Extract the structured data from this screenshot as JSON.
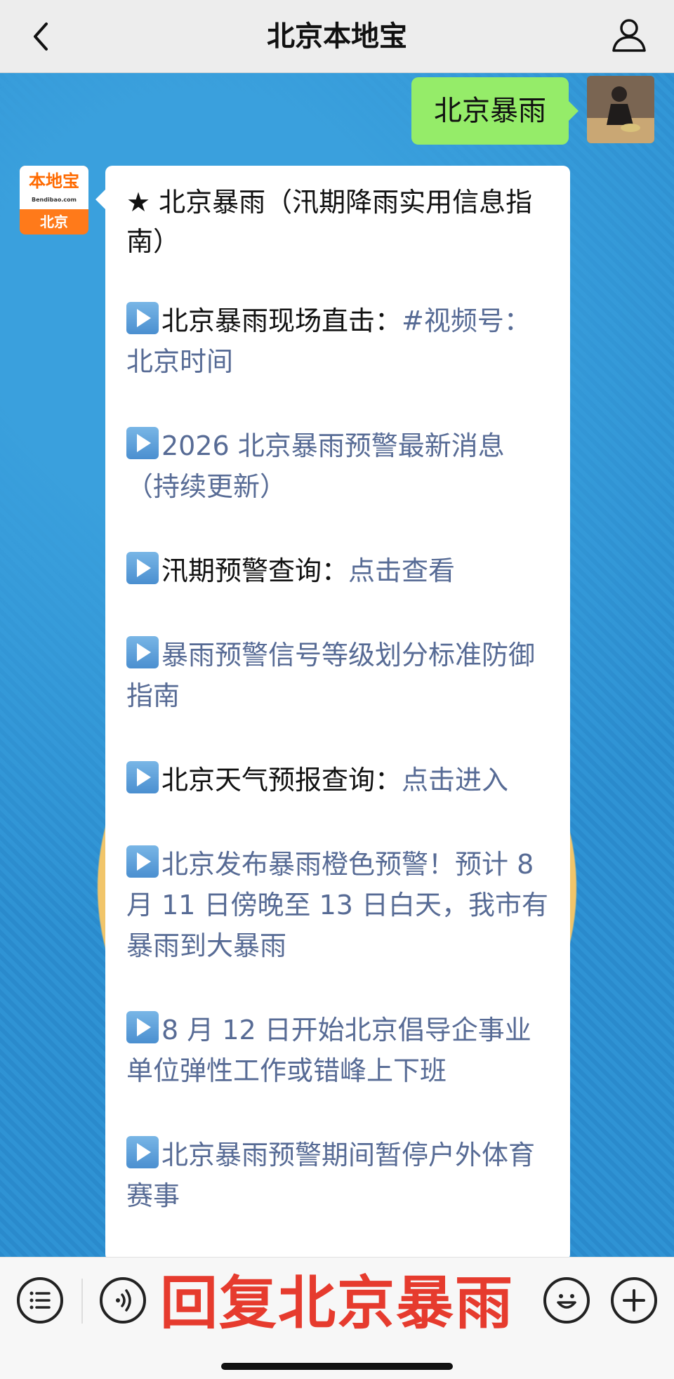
{
  "header": {
    "title": "北京本地宝"
  },
  "chat": {
    "my_message": "北京暴雨",
    "bot_avatar": {
      "logo_text": "本地宝",
      "logo_sub": "Bendibao.com",
      "city": "北京"
    },
    "bubble": {
      "title": "★ 北京暴雨（汛期降雨实用信息指南）",
      "items": [
        {
          "prefix": "北京暴雨现场直击：",
          "link": "#视频号：北京时间"
        },
        {
          "prefix": "",
          "link": "2026 北京暴雨预警最新消息（持续更新）"
        },
        {
          "prefix": "汛期预警查询：",
          "link": "点击查看"
        },
        {
          "prefix": "",
          "link": "暴雨预警信号等级划分标准防御指南"
        },
        {
          "prefix": "北京天气预报查询：",
          "link": "点击进入"
        },
        {
          "prefix": "",
          "link": "北京发布暴雨橙色预警！预计 8 月 11 日傍晚至 13 日白天，我市有暴雨到大暴雨"
        },
        {
          "prefix": "",
          "link": "8 月 12 日开始北京倡导企事业单位弹性工作或错峰上下班"
        },
        {
          "prefix": "",
          "link": "北京暴雨预警期间暂停户外体育赛事"
        }
      ]
    }
  },
  "bottom_bar": {
    "reply_text": "回复北京暴雨"
  },
  "colors": {
    "header_bg": "#ededed",
    "my_bubble": "#95ec69",
    "link": "#576b95",
    "reply_text": "#e63b2e"
  },
  "icons": [
    "back-chevron-icon",
    "profile-icon",
    "menu-list-icon",
    "voice-icon",
    "emoji-icon",
    "plus-icon",
    "play-icon"
  ]
}
